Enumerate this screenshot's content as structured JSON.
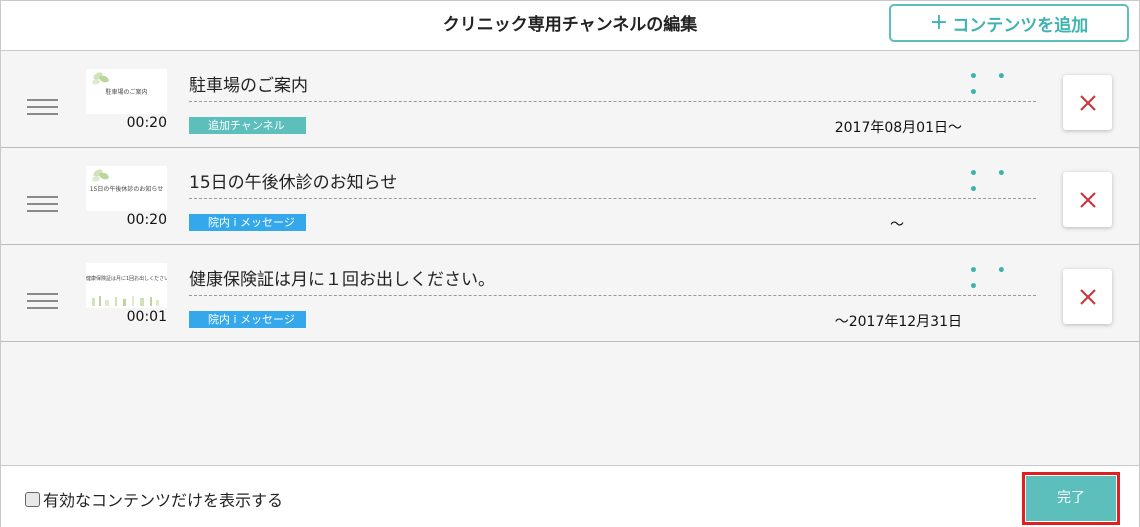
{
  "header": {
    "title": "クリニック専用チャンネルの編集",
    "add_button_plus": "+",
    "add_button_label": "コンテンツを追加"
  },
  "rows": [
    {
      "title": "駐車場のご案内",
      "thumb_text": "駐車場のご案内",
      "duration": "00:20",
      "badge": "追加チャンネル",
      "badge_color": "#5dbfbc",
      "date": "2017年08月01日〜",
      "more": "• • •",
      "delete_icon": "close-icon"
    },
    {
      "title": "15日の午後休診のお知らせ",
      "thumb_text": "15日の午後休診のお知らせ",
      "duration": "00:20",
      "badge": "院内 i メッセージ",
      "badge_color": "#35a8ec",
      "date": "〜",
      "more": "• • •",
      "delete_icon": "close-icon"
    },
    {
      "title": "健康保険証は月に１回お出しください。",
      "thumb_text": "健康保険証は月に1回お出しください。",
      "duration": "00:01",
      "badge": "院内 i メッセージ",
      "badge_color": "#35a8ec",
      "date": "〜2017年12月31日",
      "more": "• • •",
      "delete_icon": "close-icon"
    }
  ],
  "footer": {
    "filter_label": "有効なコンテンツだけを表示する",
    "filter_checked": false,
    "done_label": "完了"
  },
  "colors": {
    "accent": "#5dbfbc",
    "blue_badge": "#35a8ec",
    "delete": "#d0313a",
    "highlight": "#e02020"
  }
}
